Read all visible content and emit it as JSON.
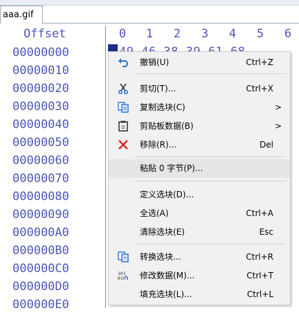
{
  "tab": {
    "filename": "aaa.gif"
  },
  "header": {
    "offset_label": "Offset",
    "columns": [
      "0",
      "1",
      "2",
      "3",
      "4",
      "5",
      "6"
    ]
  },
  "offsets": [
    "00000000",
    "00000010",
    "00000020",
    "00000030",
    "00000040",
    "00000050",
    "00000060",
    "00000070",
    "00000080",
    "00000090",
    "000000A0",
    "000000B0",
    "000000C0",
    "000000D0",
    "000000E0"
  ],
  "hex_peek": "49 46 38 39 61 68",
  "context_menu": {
    "items": [
      {
        "label": "撤销(U)",
        "shortcut": "Ctrl+Z",
        "icon": "undo-icon"
      },
      {
        "label": "剪切(T)...",
        "shortcut": "Ctrl+X",
        "icon": "scissors-icon"
      },
      {
        "label": "复制选块(C)",
        "shortcut": "",
        "icon": "copy-icon",
        "submenu": true
      },
      {
        "label": "剪贴板数据(B)",
        "shortcut": "",
        "icon": "clipboard-icon",
        "submenu": true
      },
      {
        "label": "移除(R)...",
        "shortcut": "Del",
        "icon": "remove-x-icon"
      },
      {
        "label": "粘贴 0 字节(P)...",
        "shortcut": "",
        "icon": ""
      },
      {
        "label": "定义选块(D)...",
        "shortcut": "",
        "icon": ""
      },
      {
        "label": "全选(A)",
        "shortcut": "Ctrl+A",
        "icon": ""
      },
      {
        "label": "清除选块(E)",
        "shortcut": "Esc",
        "icon": ""
      },
      {
        "label": "转换选块...",
        "shortcut": "Ctrl+R",
        "icon": "convert-icon"
      },
      {
        "label": "修改数据(M)...",
        "shortcut": "Ctrl+T",
        "icon": "modify-data-icon"
      },
      {
        "label": "填充选块(L)...",
        "shortcut": "Ctrl+L",
        "icon": ""
      }
    ],
    "submenu_arrow": ">"
  },
  "colors": {
    "hex_text": "#4d57b8",
    "selection": "#1c2c8c",
    "remove_icon": "#d9261c",
    "undo_icon": "#2a6fd6"
  }
}
